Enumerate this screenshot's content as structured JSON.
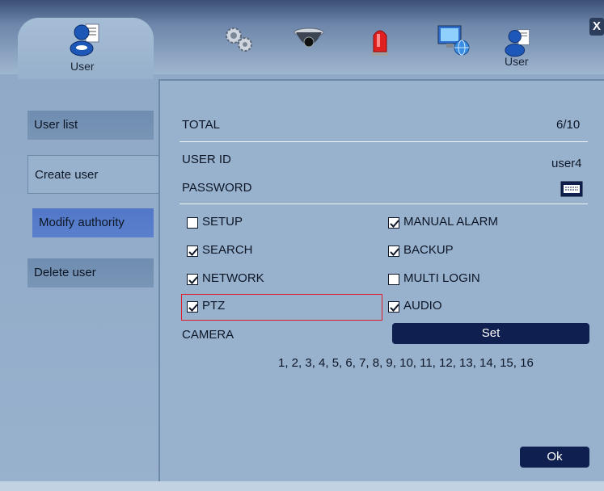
{
  "window": {
    "close_label": "X",
    "tabs": [
      {
        "label": "User",
        "icon": "user-icon",
        "active": true
      },
      {
        "label": "",
        "icon": "gears-icon"
      },
      {
        "label": "",
        "icon": "dome-camera-icon"
      },
      {
        "label": "",
        "icon": "alarm-beacon-icon"
      },
      {
        "label": "",
        "icon": "network-monitor-icon"
      },
      {
        "label": "User",
        "icon": "user-icon"
      }
    ]
  },
  "sidebar": {
    "items": [
      {
        "label": "User list"
      },
      {
        "label": "Create user"
      },
      {
        "label": "Modify authority",
        "selected": true
      },
      {
        "label": "Delete user"
      }
    ]
  },
  "panel": {
    "total_label": "TOTAL",
    "total_value": "6/10",
    "user_id_label": "USER ID",
    "user_id_value": "user4",
    "password_label": "PASSWORD",
    "password_icon": "keyboard-icon",
    "permissions": [
      {
        "label": "SETUP",
        "checked": false
      },
      {
        "label": "MANUAL ALARM",
        "checked": true
      },
      {
        "label": "SEARCH",
        "checked": true
      },
      {
        "label": "BACKUP",
        "checked": true
      },
      {
        "label": "NETWORK",
        "checked": true
      },
      {
        "label": "MULTI LOGIN",
        "checked": false
      },
      {
        "label": "PTZ",
        "checked": true
      },
      {
        "label": "AUDIO",
        "checked": true
      }
    ],
    "camera_label": "CAMERA",
    "set_button": "Set",
    "camera_list": "1, 2, 3, 4, 5, 6, 7, 8, 9, 10, 11, 12, 13, 14, 15, 16",
    "ok_button": "Ok"
  },
  "colors": {
    "accent": "#0f2050",
    "selected_item": "#5277c7",
    "highlight": "#e11c2a",
    "panel_bg": "#98b1cd"
  }
}
